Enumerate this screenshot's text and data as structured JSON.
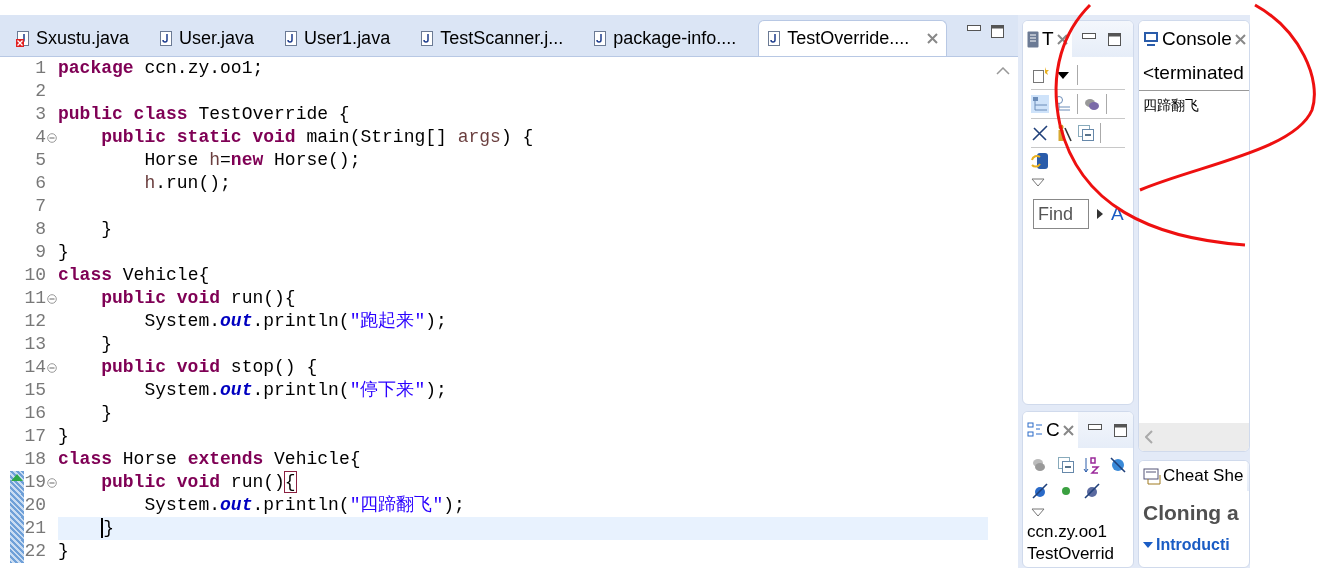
{
  "editor": {
    "tabs": [
      {
        "label": "Sxustu.java",
        "selected": false,
        "error": true
      },
      {
        "label": "User.java",
        "selected": false,
        "error": false
      },
      {
        "label": "User1.java",
        "selected": false,
        "error": false
      },
      {
        "label": "TestScanner.j...",
        "selected": false,
        "error": false
      },
      {
        "label": "package-info....",
        "selected": false,
        "error": false
      },
      {
        "label": "TestOverride....",
        "selected": true,
        "error": false
      }
    ],
    "lines": [
      {
        "number": "1",
        "foldable": false,
        "current": false,
        "changed": false,
        "override": false,
        "tokens": [
          {
            "kind": "keyword",
            "text": "package"
          },
          {
            "kind": "plain",
            "text": " ccn.zy.oo1;"
          }
        ]
      },
      {
        "number": "2",
        "foldable": false,
        "current": false,
        "changed": false,
        "override": false
      },
      {
        "number": "3",
        "foldable": false,
        "current": false,
        "changed": false,
        "override": false,
        "tokens": [
          {
            "kind": "keyword",
            "text": "public class"
          },
          {
            "kind": "plain",
            "text": " TestOverride {"
          }
        ],
        "children": [
          {
            "number": "4",
            "foldable": true,
            "current": false,
            "changed": false,
            "override": false,
            "tokens": [
              {
                "kind": "keyword",
                "text": "public static void"
              },
              {
                "kind": "plain",
                "text": " main(String[] "
              },
              {
                "kind": "local",
                "text": "args"
              },
              {
                "kind": "plain",
                "text": ") {"
              }
            ],
            "children": [
              {
                "number": "5",
                "foldable": false,
                "current": false,
                "changed": false,
                "override": false,
                "tokens": [
                  {
                    "kind": "plain",
                    "text": "Horse "
                  },
                  {
                    "kind": "local",
                    "text": "h"
                  },
                  {
                    "kind": "plain",
                    "text": "="
                  },
                  {
                    "kind": "keyword",
                    "text": "new"
                  },
                  {
                    "kind": "plain",
                    "text": " Horse();"
                  }
                ]
              },
              {
                "number": "6",
                "foldable": false,
                "current": false,
                "changed": false,
                "override": false,
                "tokens": [
                  {
                    "kind": "local",
                    "text": "h"
                  },
                  {
                    "kind": "plain",
                    "text": ".run();"
                  }
                ]
              },
              {
                "number": "7",
                "foldable": false,
                "current": false,
                "changed": false,
                "override": false
              }
            ]
          },
          {
            "number": "8",
            "foldable": false,
            "current": false,
            "changed": false,
            "override": false,
            "tokens": [
              {
                "kind": "plain",
                "text": "}"
              }
            ]
          }
        ]
      },
      {
        "number": "9",
        "foldable": false,
        "current": false,
        "changed": false,
        "override": false,
        "tokens": [
          {
            "kind": "plain",
            "text": "}"
          }
        ]
      },
      {
        "number": "10",
        "foldable": false,
        "current": false,
        "changed": false,
        "override": false,
        "tokens": [
          {
            "kind": "keyword",
            "text": "class"
          },
          {
            "kind": "plain",
            "text": " Vehicle{"
          }
        ],
        "children": [
          {
            "number": "11",
            "foldable": true,
            "current": false,
            "changed": false,
            "override": false,
            "tokens": [
              {
                "kind": "keyword",
                "text": "public void"
              },
              {
                "kind": "plain",
                "text": " run(){"
              }
            ],
            "children": [
              {
                "number": "12",
                "foldable": false,
                "current": false,
                "changed": false,
                "override": false,
                "tokens": [
                  {
                    "kind": "plain",
                    "text": "System."
                  },
                  {
                    "kind": "field",
                    "text": "out"
                  },
                  {
                    "kind": "plain",
                    "text": ".println("
                  },
                  {
                    "kind": "string",
                    "text": "\"跑起来\""
                  },
                  {
                    "kind": "plain",
                    "text": ");"
                  }
                ]
              }
            ]
          },
          {
            "number": "13",
            "foldable": false,
            "current": false,
            "changed": false,
            "override": false,
            "tokens": [
              {
                "kind": "plain",
                "text": "}"
              }
            ]
          },
          {
            "number": "14",
            "foldable": true,
            "current": false,
            "changed": false,
            "override": false,
            "tokens": [
              {
                "kind": "keyword",
                "text": "public void"
              },
              {
                "kind": "plain",
                "text": " stop() {"
              }
            ],
            "children": [
              {
                "number": "15",
                "foldable": false,
                "current": false,
                "changed": false,
                "override": false,
                "tokens": [
                  {
                    "kind": "plain",
                    "text": "System."
                  },
                  {
                    "kind": "field",
                    "text": "out"
                  },
                  {
                    "kind": "plain",
                    "text": ".println("
                  },
                  {
                    "kind": "string",
                    "text": "\"停下来\""
                  },
                  {
                    "kind": "plain",
                    "text": ");"
                  }
                ]
              }
            ]
          },
          {
            "number": "16",
            "foldable": false,
            "current": false,
            "changed": false,
            "override": false,
            "tokens": [
              {
                "kind": "plain",
                "text": "}"
              }
            ]
          }
        ]
      },
      {
        "number": "17",
        "foldable": false,
        "current": false,
        "changed": false,
        "override": false,
        "tokens": [
          {
            "kind": "plain",
            "text": "}"
          }
        ]
      },
      {
        "number": "18",
        "foldable": false,
        "current": false,
        "changed": false,
        "override": false,
        "tokens": [
          {
            "kind": "keyword",
            "text": "class"
          },
          {
            "kind": "plain",
            "text": " Horse "
          },
          {
            "kind": "keyword",
            "text": "extends"
          },
          {
            "kind": "plain",
            "text": " Vehicle{"
          }
        ],
        "children": [
          {
            "number": "19",
            "foldable": true,
            "current": false,
            "changed": true,
            "override": true,
            "tokens": [
              {
                "kind": "keyword",
                "text": "public void"
              },
              {
                "kind": "plain",
                "text": " run()"
              },
              {
                "kind": "matched-bracket",
                "text": "{"
              }
            ],
            "children": [
              {
                "number": "20",
                "foldable": false,
                "current": false,
                "changed": true,
                "override": false,
                "tokens": [
                  {
                    "kind": "plain",
                    "text": "System."
                  },
                  {
                    "kind": "field",
                    "text": "out"
                  },
                  {
                    "kind": "plain",
                    "text": ".println("
                  },
                  {
                    "kind": "string",
                    "text": "\"四蹄翻飞\""
                  },
                  {
                    "kind": "plain",
                    "text": ");"
                  }
                ]
              }
            ]
          },
          {
            "number": "21",
            "foldable": false,
            "current": true,
            "changed": true,
            "override": false,
            "tokens": [
              {
                "kind": "cursor",
                "text": "}"
              }
            ]
          }
        ]
      },
      {
        "number": "22",
        "foldable": false,
        "current": false,
        "changed": true,
        "override": false,
        "tokens": [
          {
            "kind": "plain",
            "text": "}"
          }
        ]
      }
    ]
  },
  "task_list": {
    "tab_label": "T",
    "find_placeholder": "Find",
    "link": "A"
  },
  "outline": {
    "tab_label": "C",
    "items": [
      "ccn.zy.oo1",
      "TestOverrid"
    ]
  },
  "console": {
    "tab_label": "Console",
    "header": "<terminated",
    "output": [
      "四蹄翻飞"
    ]
  },
  "cheat_sheet": {
    "tab_label": "Cheat She",
    "title": "Cloning a",
    "section": "Introducti"
  }
}
